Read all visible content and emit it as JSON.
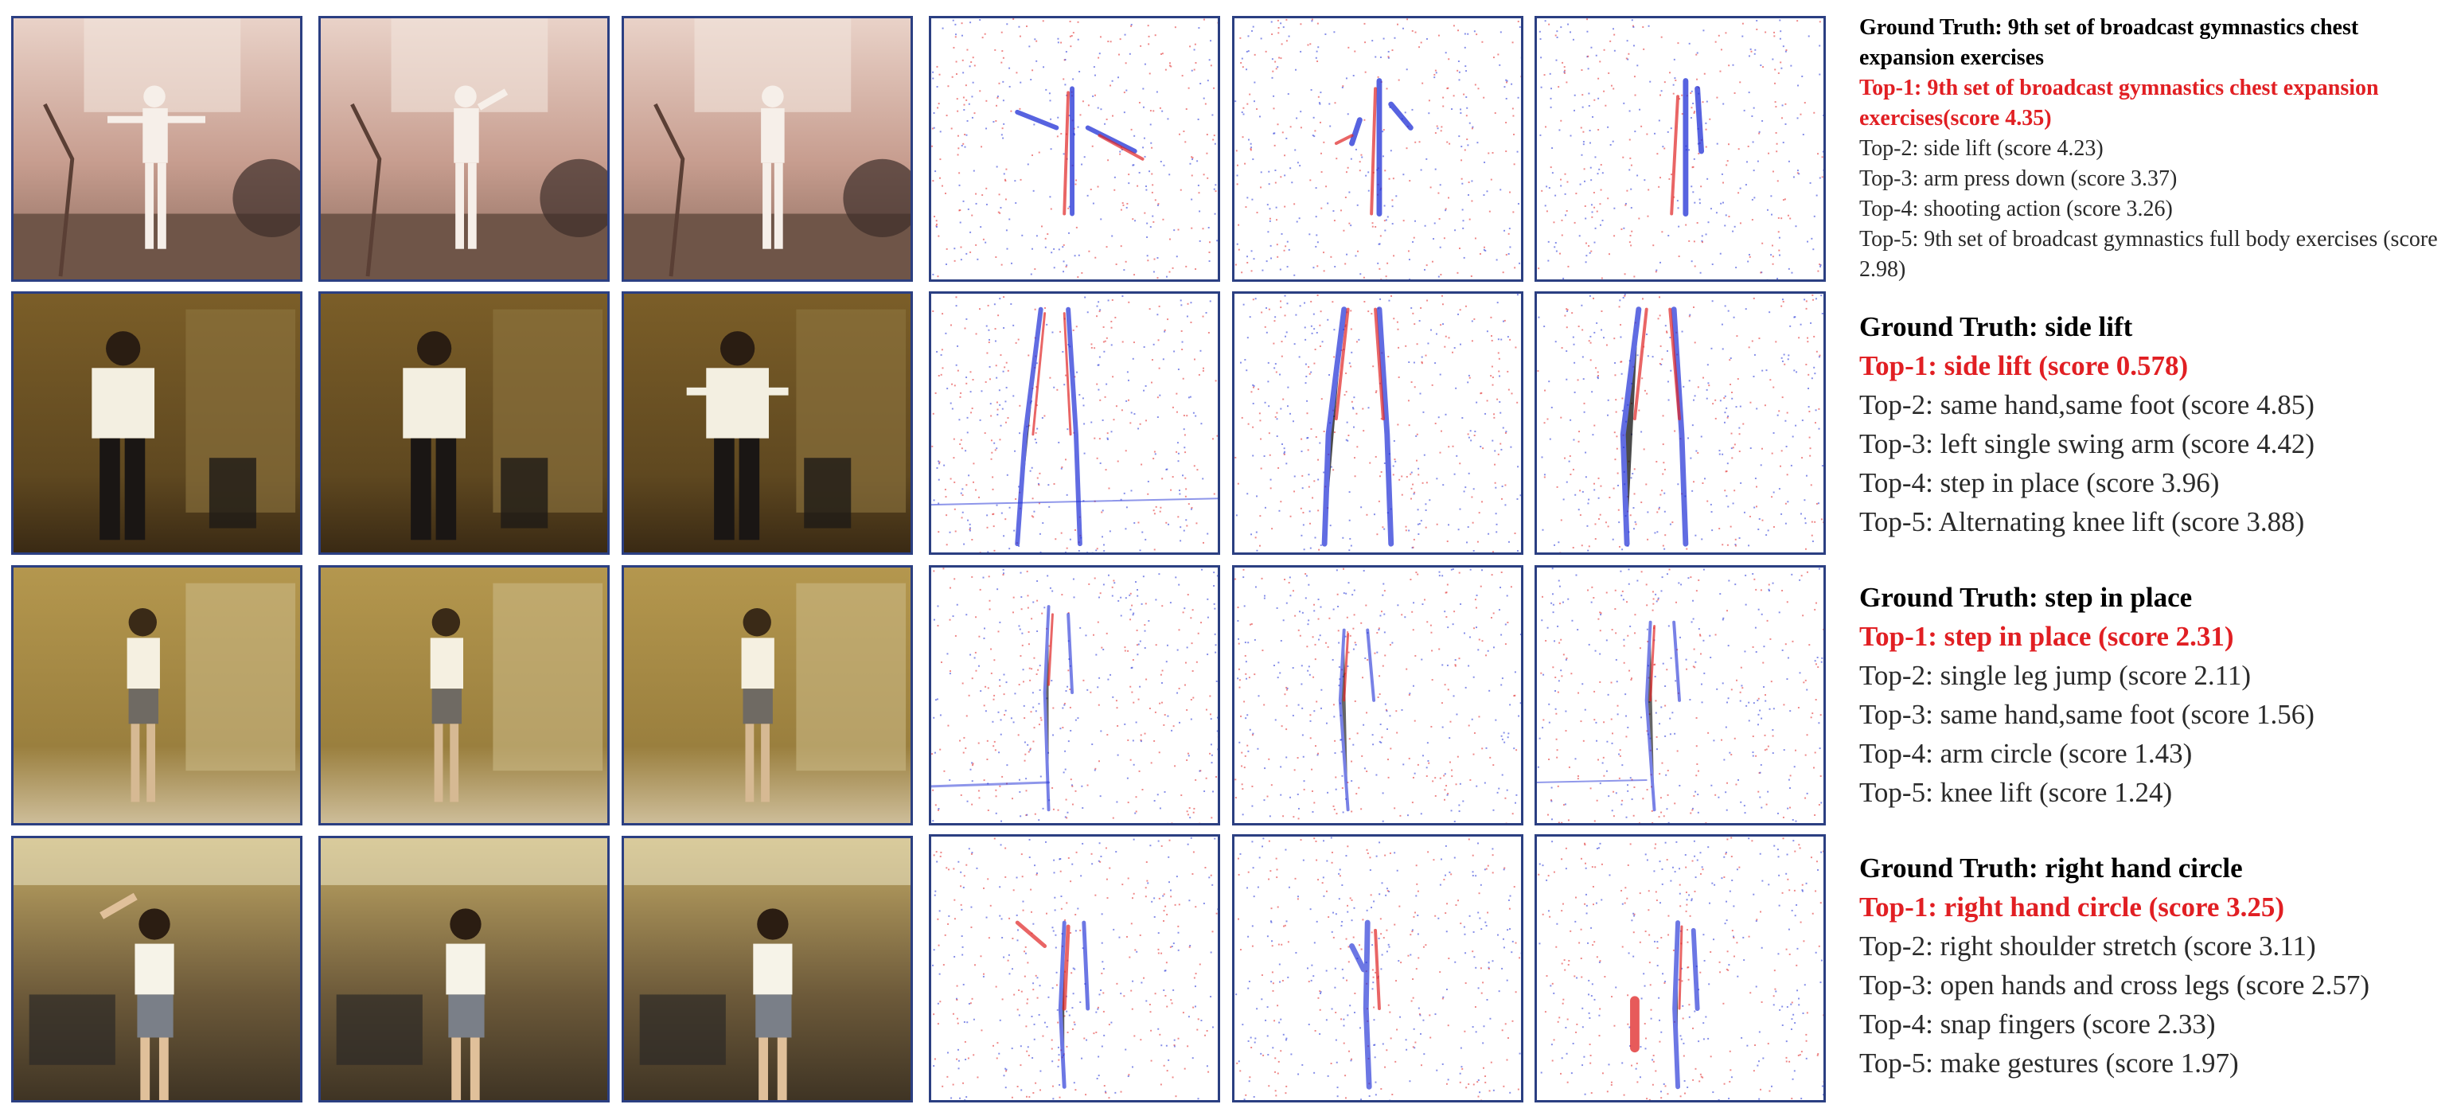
{
  "rows": [
    {
      "ground_truth": "Ground Truth: 9th set of broadcast gymnastics chest expansion exercises",
      "top1": "Top-1: 9th set of broadcast gymnastics chest expansion exercises(score 4.35)",
      "others": [
        "Top-2: side lift (score 4.23)",
        "Top-3: arm press down (score 3.37)",
        "Top-4: shooting action (score 3.26)",
        "Top-5: 9th set of broadcast gymnastics full body exercises (score 2.98)"
      ]
    },
    {
      "ground_truth": "Ground Truth: side lift",
      "top1": "Top-1: side lift (score 0.578)",
      "others": [
        "Top-2: same hand,same foot (score 4.85)",
        "Top-3: left single swing arm (score 4.42)",
        "Top-4: step in place (score 3.96)",
        "Top-5: Alternating knee lift (score 3.88)"
      ]
    },
    {
      "ground_truth": "Ground Truth: step in place",
      "top1": "Top-1: step in place (score 2.31)",
      "others": [
        "Top-2: single leg jump (score 2.11)",
        "Top-3: same hand,same foot (score 1.56)",
        "Top-4: arm circle (score 1.43)",
        "Top-5: knee lift (score 1.24)"
      ]
    },
    {
      "ground_truth": "Ground Truth: right hand circle",
      "top1": "Top-1: right hand circle (score 3.25)",
      "others": [
        "Top-2: right shoulder stretch (score 3.11)",
        "Top-3: open hands and cross legs (score 2.57)",
        "Top-4: snap fingers (score 2.33)",
        "Top-5: make gestures (score 1.97)"
      ]
    }
  ],
  "colors": {
    "frame_border": "#2b3f82",
    "ground_truth": "#000000",
    "top1": "#e11f23",
    "other": "#2a2a2a",
    "event_positive": "#1f2fd6",
    "event_negative": "#e02424"
  }
}
